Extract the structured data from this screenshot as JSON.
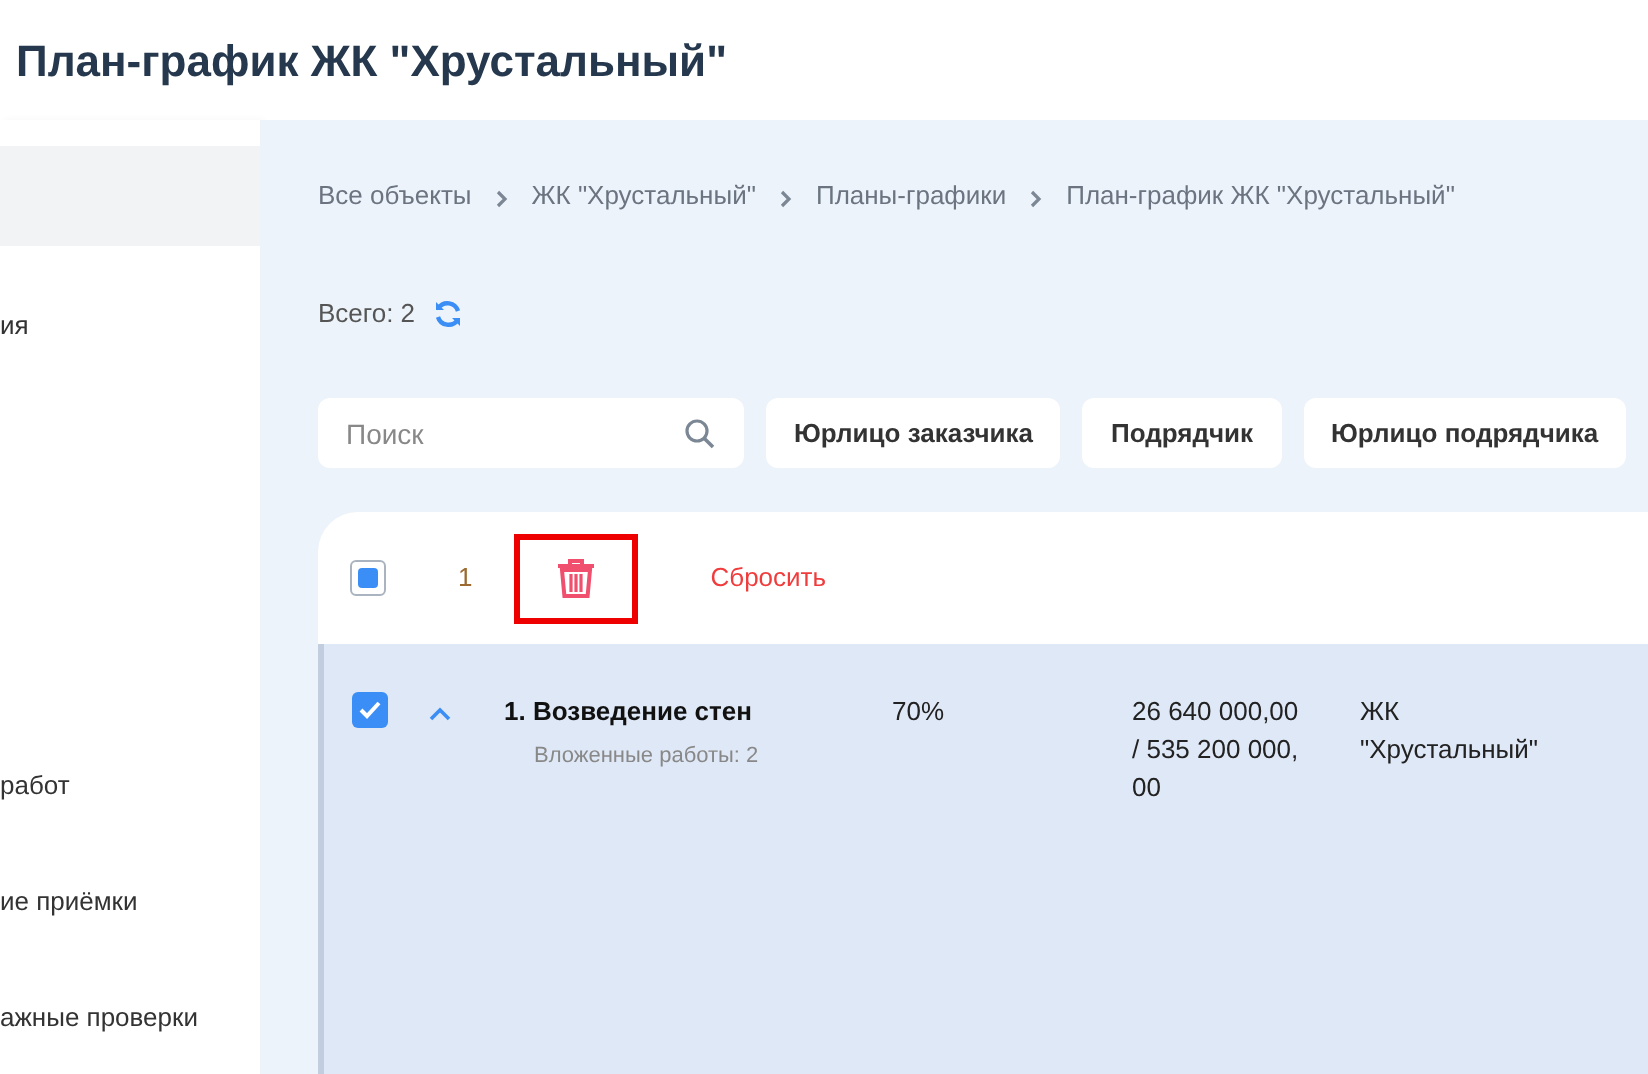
{
  "title": "План-график ЖК \"Хрустальный\"",
  "sidebar": {
    "items": [
      {
        "selected": true
      },
      {
        "label": "ия",
        "selected": false
      },
      {
        "label": "работ",
        "selected": false
      },
      {
        "label": "ие приёмки",
        "selected": false
      },
      {
        "label": "ажные проверки",
        "selected": false
      }
    ]
  },
  "breadcrumbs": [
    "Все объекты",
    "ЖК \"Хрустальный\"",
    "Планы-графики",
    "План-график ЖК \"Хрустальный\""
  ],
  "total": "Всего: 2",
  "search": {
    "placeholder": "Поиск"
  },
  "filters": [
    "Юрлицо заказчика",
    "Подрядчик",
    "Юрлицо подрядчика"
  ],
  "selection": {
    "checked": false,
    "indeterminate": true,
    "count": "1",
    "highlighted": true,
    "reset": "Сбросить"
  },
  "rows": [
    {
      "title": "1. Возведение стен",
      "subtitle": "Вложенные работы: 2",
      "checked": true,
      "expanded": true,
      "selected": true,
      "progress": "70%",
      "amount": "26 640 000,00 / 535 200 000,00",
      "object": "ЖК \"Хрустальный\""
    }
  ]
}
